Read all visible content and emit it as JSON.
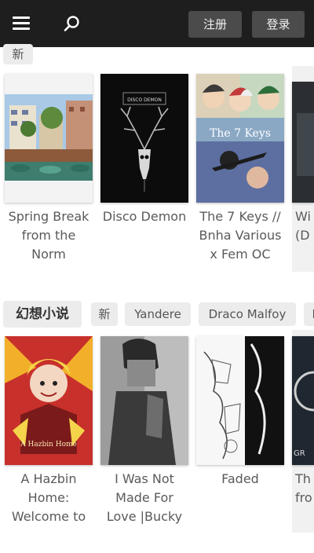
{
  "header": {
    "register_label": "注册",
    "login_label": "登录"
  },
  "section_new": {
    "tag_label": "新",
    "stories": [
      {
        "title_lines": [
          "Spring Break",
          "from the",
          "Norm"
        ],
        "cover_text": ""
      },
      {
        "title_lines": [
          "Disco Demon",
          "",
          ""
        ],
        "cover_text": "DISCO DEMON"
      },
      {
        "title_lines": [
          "The 7 Keys //",
          "Bnha Various",
          "x Fem OC"
        ],
        "cover_text": "The 7 Keys"
      },
      {
        "title_lines": [
          "Wi",
          "(D",
          ""
        ],
        "cover_text": ""
      }
    ]
  },
  "section_fantasy": {
    "title": "幻想小说",
    "tags": [
      "新",
      "Yandere",
      "Draco Malfoy",
      "P"
    ],
    "stories": [
      {
        "title_lines": [
          "A Hazbin",
          "Home:",
          "Welcome to"
        ],
        "cover_text": "A Hazbin Home"
      },
      {
        "title_lines": [
          "I Was Not",
          "Made For",
          "Love |Bucky"
        ],
        "cover_text": ""
      },
      {
        "title_lines": [
          "Faded",
          "",
          ""
        ],
        "cover_text": ""
      },
      {
        "title_lines": [
          "Th",
          "fro",
          ""
        ],
        "cover_text": "GR"
      }
    ]
  },
  "colors": {
    "header_bg": "#1e1e1e",
    "header_button_bg": "#4b4b4b",
    "chip_bg": "#ececec",
    "title_text": "#5a5a5a"
  },
  "icons": {
    "menu": "hamburger-menu-icon",
    "search": "search-icon"
  }
}
